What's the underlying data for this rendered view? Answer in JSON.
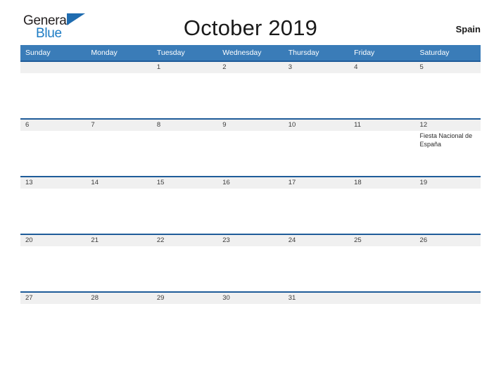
{
  "brand": {
    "word_one": "General",
    "word_two": "Blue",
    "flag_icon": "triangle-flag-icon",
    "color_dark": "#231f20",
    "color_blue": "#1d7cc4"
  },
  "header": {
    "title": "October 2019",
    "country": "Spain"
  },
  "theme": {
    "header_blue": "#3a7cb8",
    "rule_blue": "#1f5c99",
    "band_gray": "#f0f0f0",
    "text_dark": "#1a1a1a"
  },
  "calendar": {
    "weekday_headers": [
      "Sunday",
      "Monday",
      "Tuesday",
      "Wednesday",
      "Thursday",
      "Friday",
      "Saturday"
    ],
    "weeks": [
      [
        {
          "date": "",
          "events": []
        },
        {
          "date": "",
          "events": []
        },
        {
          "date": "1",
          "events": []
        },
        {
          "date": "2",
          "events": []
        },
        {
          "date": "3",
          "events": []
        },
        {
          "date": "4",
          "events": []
        },
        {
          "date": "5",
          "events": []
        }
      ],
      [
        {
          "date": "6",
          "events": []
        },
        {
          "date": "7",
          "events": []
        },
        {
          "date": "8",
          "events": []
        },
        {
          "date": "9",
          "events": []
        },
        {
          "date": "10",
          "events": []
        },
        {
          "date": "11",
          "events": []
        },
        {
          "date": "12",
          "events": [
            "Fiesta Nacional de España"
          ]
        }
      ],
      [
        {
          "date": "13",
          "events": []
        },
        {
          "date": "14",
          "events": []
        },
        {
          "date": "15",
          "events": []
        },
        {
          "date": "16",
          "events": []
        },
        {
          "date": "17",
          "events": []
        },
        {
          "date": "18",
          "events": []
        },
        {
          "date": "19",
          "events": []
        }
      ],
      [
        {
          "date": "20",
          "events": []
        },
        {
          "date": "21",
          "events": []
        },
        {
          "date": "22",
          "events": []
        },
        {
          "date": "23",
          "events": []
        },
        {
          "date": "24",
          "events": []
        },
        {
          "date": "25",
          "events": []
        },
        {
          "date": "26",
          "events": []
        }
      ],
      [
        {
          "date": "27",
          "events": []
        },
        {
          "date": "28",
          "events": []
        },
        {
          "date": "29",
          "events": []
        },
        {
          "date": "30",
          "events": []
        },
        {
          "date": "31",
          "events": []
        },
        {
          "date": "",
          "events": []
        },
        {
          "date": "",
          "events": []
        }
      ]
    ]
  }
}
